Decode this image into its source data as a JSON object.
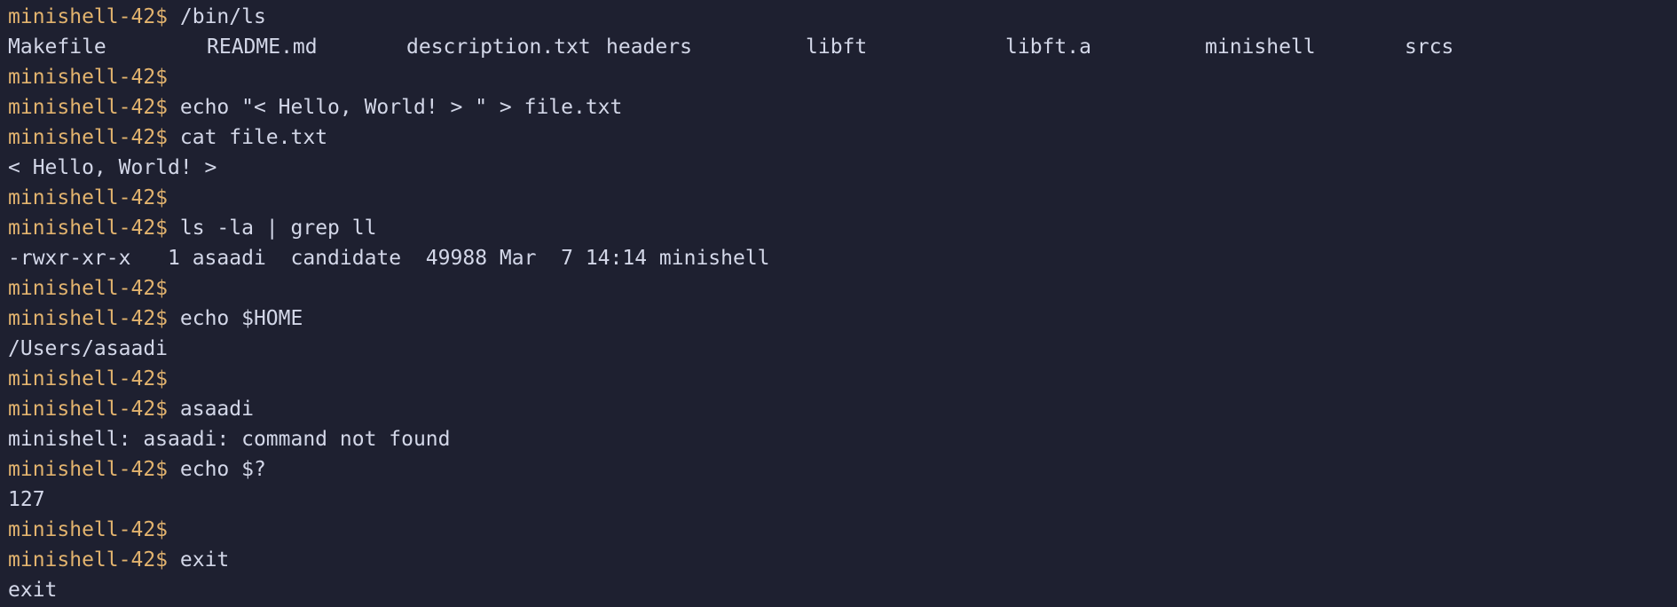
{
  "colors": {
    "background": "#1e2030",
    "prompt": "#e2b36e",
    "text": "#d3d7e8"
  },
  "prompt": "minishell-42$",
  "lines": [
    {
      "type": "cmd",
      "text": "/bin/ls"
    },
    {
      "type": "ls",
      "items": [
        "Makefile",
        "README.md",
        "description.txt",
        "headers",
        "libft",
        "libft.a",
        "minishell",
        "srcs"
      ]
    },
    {
      "type": "cmd",
      "text": ""
    },
    {
      "type": "cmd",
      "text": "echo \"< Hello, World! > \" > file.txt"
    },
    {
      "type": "cmd",
      "text": "cat file.txt"
    },
    {
      "type": "out",
      "text": "< Hello, World! >"
    },
    {
      "type": "cmd",
      "text": ""
    },
    {
      "type": "cmd",
      "text": "ls -la | grep ll"
    },
    {
      "type": "out",
      "text": "-rwxr-xr-x   1 asaadi  candidate  49988 Mar  7 14:14 minishell"
    },
    {
      "type": "cmd",
      "text": ""
    },
    {
      "type": "cmd",
      "text": "echo $HOME"
    },
    {
      "type": "out",
      "text": "/Users/asaadi"
    },
    {
      "type": "cmd",
      "text": ""
    },
    {
      "type": "cmd",
      "text": "asaadi"
    },
    {
      "type": "out",
      "text": "minishell: asaadi: command not found"
    },
    {
      "type": "cmd",
      "text": "echo $?"
    },
    {
      "type": "out",
      "text": "127"
    },
    {
      "type": "cmd",
      "text": ""
    },
    {
      "type": "cmd",
      "text": "exit"
    },
    {
      "type": "out",
      "text": "exit"
    }
  ]
}
